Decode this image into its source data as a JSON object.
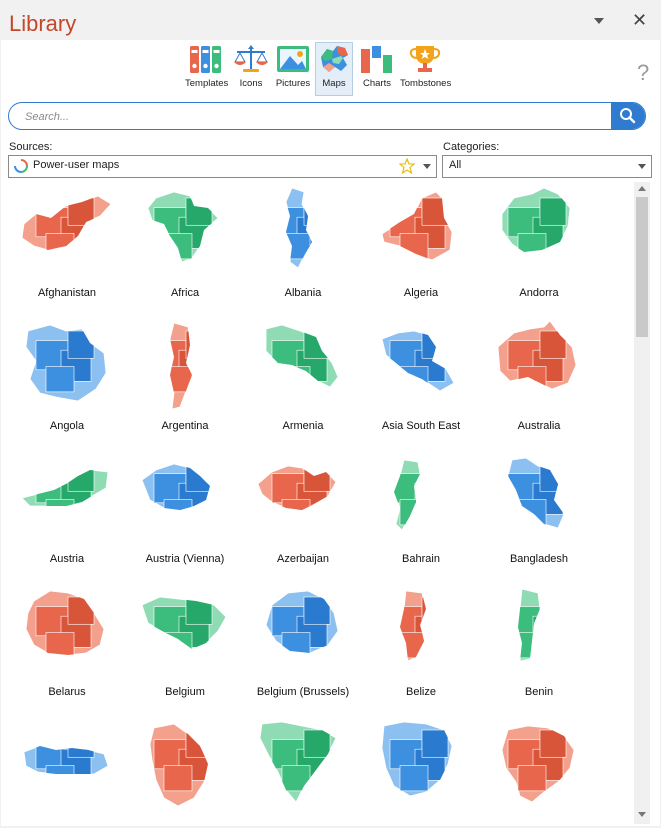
{
  "window": {
    "title": "Library"
  },
  "toolbar": {
    "items": [
      {
        "label": "Templates",
        "icon": "binders-icon"
      },
      {
        "label": "Icons",
        "icon": "scales-icon"
      },
      {
        "label": "Pictures",
        "icon": "picture-icon"
      },
      {
        "label": "Maps",
        "icon": "map-icon",
        "active": true
      },
      {
        "label": "Charts",
        "icon": "bar-chart-icon"
      },
      {
        "label": "Tombstones",
        "icon": "trophy-icon"
      }
    ],
    "help": "?"
  },
  "search": {
    "placeholder": "Search..."
  },
  "sources": {
    "label": "Sources:",
    "value": "Power-user maps"
  },
  "categories": {
    "label": "Categories:",
    "value": "All"
  },
  "maps": [
    {
      "name": "Afghanistan",
      "color": "red"
    },
    {
      "name": "Africa",
      "color": "green"
    },
    {
      "name": "Albania",
      "color": "blue"
    },
    {
      "name": "Algeria",
      "color": "red"
    },
    {
      "name": "Andorra",
      "color": "green"
    },
    {
      "name": "Angola",
      "color": "blue"
    },
    {
      "name": "Argentina",
      "color": "red"
    },
    {
      "name": "Armenia",
      "color": "green"
    },
    {
      "name": "Asia South East",
      "color": "blue"
    },
    {
      "name": "Australia",
      "color": "red"
    },
    {
      "name": "Austria",
      "color": "green"
    },
    {
      "name": "Austria (Vienna)",
      "color": "blue"
    },
    {
      "name": "Azerbaijan",
      "color": "red"
    },
    {
      "name": "Bahrain",
      "color": "green"
    },
    {
      "name": "Bangladesh",
      "color": "blue"
    },
    {
      "name": "Belarus",
      "color": "red"
    },
    {
      "name": "Belgium",
      "color": "green"
    },
    {
      "name": "Belgium (Brussels)",
      "color": "blue"
    },
    {
      "name": "Belize",
      "color": "red"
    },
    {
      "name": "Benin",
      "color": "green"
    },
    {
      "name": "",
      "color": "blue"
    },
    {
      "name": "",
      "color": "red"
    },
    {
      "name": "",
      "color": "green"
    },
    {
      "name": "",
      "color": "blue"
    },
    {
      "name": "",
      "color": "red"
    }
  ],
  "palette": {
    "accent": "#2e7bcf",
    "title": "#c3472a",
    "red": [
      "#e8674c",
      "#f3a08c",
      "#d9553a",
      "#f7c3b6"
    ],
    "green": [
      "#3dbd7d",
      "#8fdcb4",
      "#27a86b",
      "#c2eed7"
    ],
    "blue": [
      "#3d8fe0",
      "#8cc0f0",
      "#2a7ad0",
      "#c4def7"
    ]
  }
}
